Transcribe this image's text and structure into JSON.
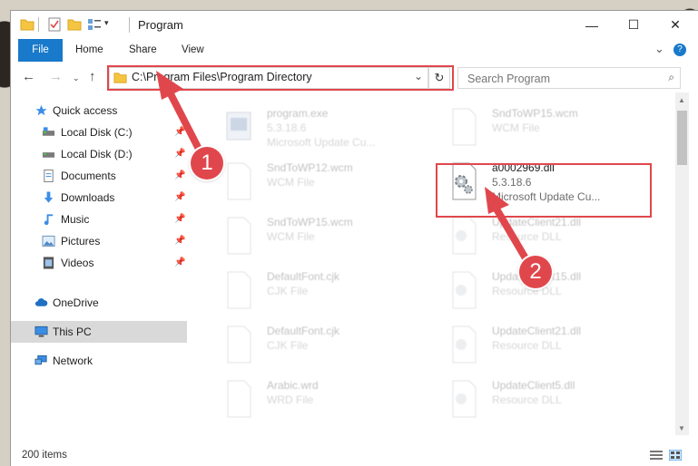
{
  "window": {
    "title": "Program",
    "controls": {
      "minimize": "—",
      "maximize": "☐",
      "close": "✕"
    }
  },
  "ribbon": {
    "tabs": [
      "File",
      "Home",
      "Share",
      "View"
    ],
    "collapse": "⌄",
    "help": "?"
  },
  "address": {
    "path": "C:\\Program Files\\Program Directory",
    "dropdown": "⌄",
    "refresh": "↻"
  },
  "search": {
    "placeholder": "Search Program"
  },
  "nav": {
    "quick_access": "Quick access",
    "items": [
      {
        "label": "Local Disk (C:)",
        "icon": "drive-icon"
      },
      {
        "label": "Local Disk (D:)",
        "icon": "drive-icon"
      },
      {
        "label": "Documents",
        "icon": "documents-icon"
      },
      {
        "label": "Downloads",
        "icon": "downloads-icon"
      },
      {
        "label": "Music",
        "icon": "music-icon"
      },
      {
        "label": "Pictures",
        "icon": "pictures-icon"
      },
      {
        "label": "Videos",
        "icon": "videos-icon"
      }
    ],
    "onedrive": "OneDrive",
    "this_pc": "This PC",
    "network": "Network"
  },
  "files": {
    "left": [
      {
        "name": "program.exe",
        "l1": "5.3.18.6",
        "l2": "Microsoft Update Cu..."
      },
      {
        "name": "SndToWP12.wcm",
        "l1": "WCM File",
        "l2": ""
      },
      {
        "name": "SndToWP15.wcm",
        "l1": "WCM File",
        "l2": ""
      },
      {
        "name": "DefaultFont.cjk",
        "l1": "CJK File",
        "l2": ""
      },
      {
        "name": "DefaultFont.cjk",
        "l1": "CJK File",
        "l2": ""
      },
      {
        "name": "Arabic.wrd",
        "l1": "WRD File",
        "l2": ""
      }
    ],
    "right": [
      {
        "name": "SndToWP15.wcm",
        "l1": "WCM File",
        "l2": ""
      },
      {
        "name": "a0002969.dll",
        "l1": "5.3.18.6",
        "l2": "Microsoft Update Cu..."
      },
      {
        "name": "UpdateClient21.dll",
        "l1": "Resource DLL",
        "l2": ""
      },
      {
        "name": "UpdateClient15.dll",
        "l1": "Resource DLL",
        "l2": ""
      },
      {
        "name": "UpdateClient21.dll",
        "l1": "Resource DLL",
        "l2": ""
      },
      {
        "name": "UpdateClient5.dll",
        "l1": "Resource DLL",
        "l2": ""
      }
    ]
  },
  "status": {
    "items": "200 items"
  },
  "callouts": {
    "one": "1",
    "two": "2"
  },
  "colors": {
    "accent": "#1979ca",
    "highlight": "#e0474c",
    "folder": "#f5c542"
  }
}
